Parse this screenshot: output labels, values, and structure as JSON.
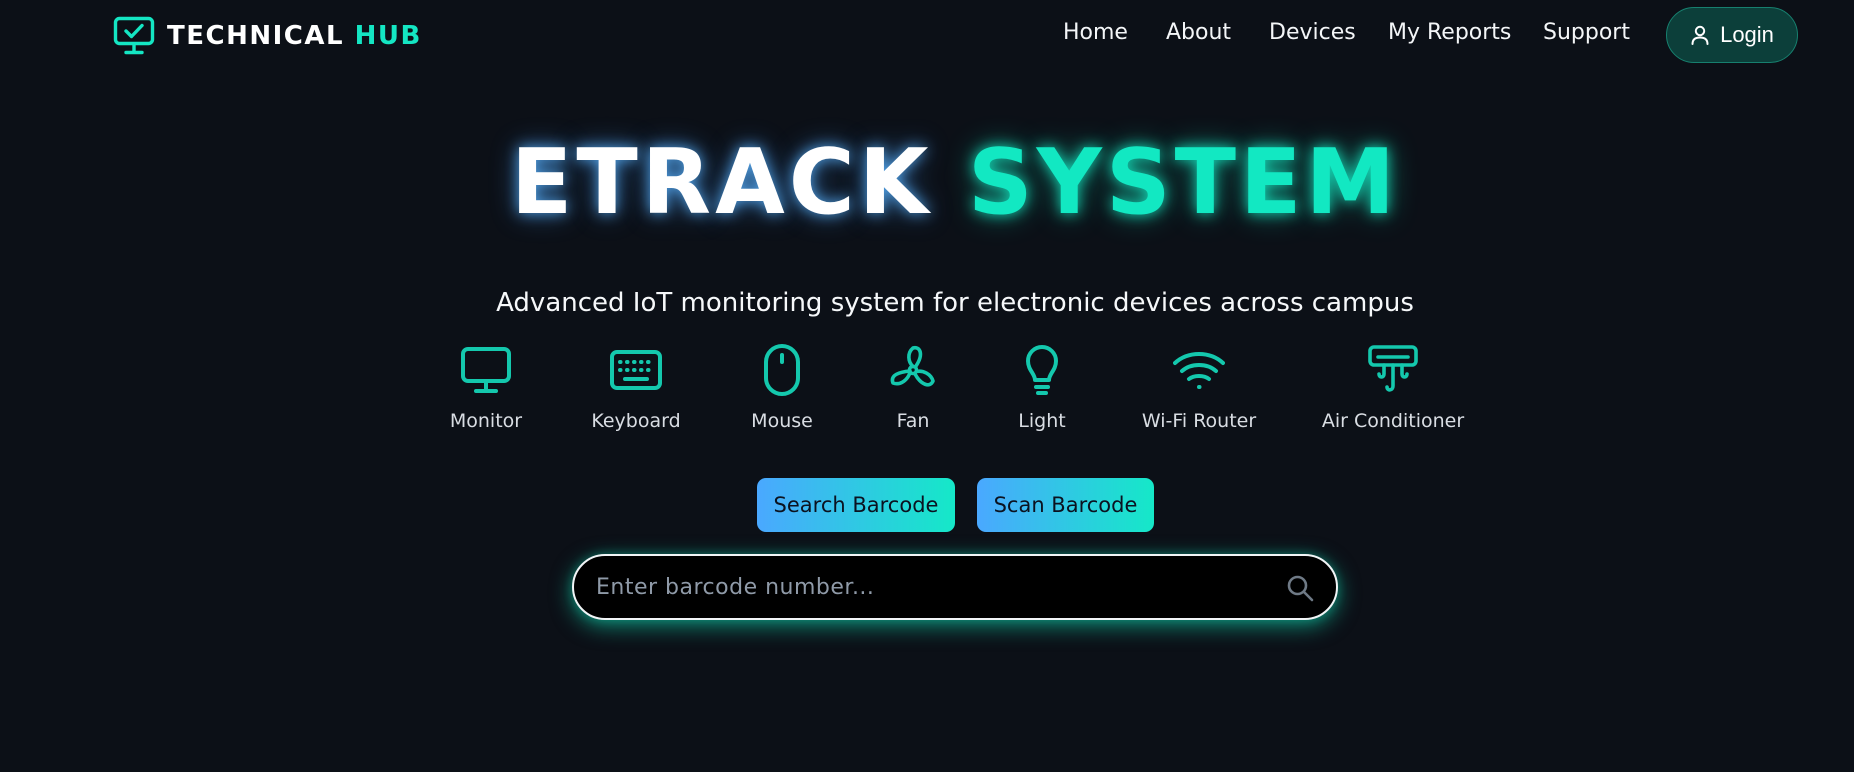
{
  "brand": {
    "icon": "monitor-check-icon",
    "name_main": "TECHNICAL ",
    "name_accent": "HUB"
  },
  "nav": {
    "links": [
      "Home",
      "About",
      "Devices",
      "My Reports",
      "Support"
    ],
    "login_label": "Login",
    "login_icon": "user-icon"
  },
  "hero": {
    "title_main": "ETRACK ",
    "title_accent": "SYSTEM",
    "subtitle": "Advanced IoT monitoring system for electronic devices across campus"
  },
  "devices": [
    {
      "label": "Monitor",
      "icon": "monitor-icon"
    },
    {
      "label": "Keyboard",
      "icon": "keyboard-icon"
    },
    {
      "label": "Mouse",
      "icon": "mouse-icon"
    },
    {
      "label": "Fan",
      "icon": "fan-icon"
    },
    {
      "label": "Light",
      "icon": "lightbulb-icon"
    },
    {
      "label": "Wi-Fi Router",
      "icon": "wifi-icon"
    },
    {
      "label": "Air Conditioner",
      "icon": "air-conditioner-icon"
    }
  ],
  "actions": {
    "search_label": "Search Barcode",
    "scan_label": "Scan Barcode"
  },
  "search": {
    "placeholder": "Enter barcode number...",
    "value": "",
    "icon": "search-icon"
  },
  "colors": {
    "background": "#0c1017",
    "accent": "#14e6c3",
    "button_gradient_start": "#4aa8ff",
    "button_gradient_end": "#15e8c8",
    "login_bg": "#0c3f3a"
  }
}
